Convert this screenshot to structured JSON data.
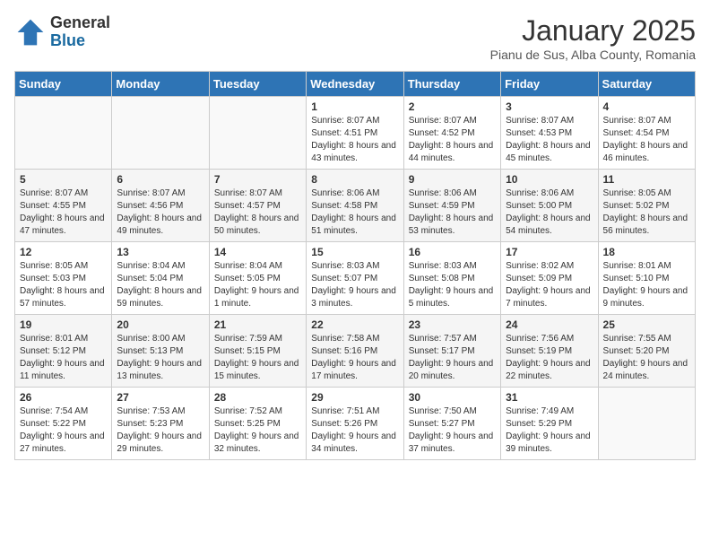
{
  "logo": {
    "general": "General",
    "blue": "Blue"
  },
  "header": {
    "title": "January 2025",
    "subtitle": "Pianu de Sus, Alba County, Romania"
  },
  "days_of_week": [
    "Sunday",
    "Monday",
    "Tuesday",
    "Wednesday",
    "Thursday",
    "Friday",
    "Saturday"
  ],
  "weeks": [
    [
      {
        "day": "",
        "info": ""
      },
      {
        "day": "",
        "info": ""
      },
      {
        "day": "",
        "info": ""
      },
      {
        "day": "1",
        "info": "Sunrise: 8:07 AM\nSunset: 4:51 PM\nDaylight: 8 hours\nand 43 minutes."
      },
      {
        "day": "2",
        "info": "Sunrise: 8:07 AM\nSunset: 4:52 PM\nDaylight: 8 hours\nand 44 minutes."
      },
      {
        "day": "3",
        "info": "Sunrise: 8:07 AM\nSunset: 4:53 PM\nDaylight: 8 hours\nand 45 minutes."
      },
      {
        "day": "4",
        "info": "Sunrise: 8:07 AM\nSunset: 4:54 PM\nDaylight: 8 hours\nand 46 minutes."
      }
    ],
    [
      {
        "day": "5",
        "info": "Sunrise: 8:07 AM\nSunset: 4:55 PM\nDaylight: 8 hours\nand 47 minutes."
      },
      {
        "day": "6",
        "info": "Sunrise: 8:07 AM\nSunset: 4:56 PM\nDaylight: 8 hours\nand 49 minutes."
      },
      {
        "day": "7",
        "info": "Sunrise: 8:07 AM\nSunset: 4:57 PM\nDaylight: 8 hours\nand 50 minutes."
      },
      {
        "day": "8",
        "info": "Sunrise: 8:06 AM\nSunset: 4:58 PM\nDaylight: 8 hours\nand 51 minutes."
      },
      {
        "day": "9",
        "info": "Sunrise: 8:06 AM\nSunset: 4:59 PM\nDaylight: 8 hours\nand 53 minutes."
      },
      {
        "day": "10",
        "info": "Sunrise: 8:06 AM\nSunset: 5:00 PM\nDaylight: 8 hours\nand 54 minutes."
      },
      {
        "day": "11",
        "info": "Sunrise: 8:05 AM\nSunset: 5:02 PM\nDaylight: 8 hours\nand 56 minutes."
      }
    ],
    [
      {
        "day": "12",
        "info": "Sunrise: 8:05 AM\nSunset: 5:03 PM\nDaylight: 8 hours\nand 57 minutes."
      },
      {
        "day": "13",
        "info": "Sunrise: 8:04 AM\nSunset: 5:04 PM\nDaylight: 8 hours\nand 59 minutes."
      },
      {
        "day": "14",
        "info": "Sunrise: 8:04 AM\nSunset: 5:05 PM\nDaylight: 9 hours\nand 1 minute."
      },
      {
        "day": "15",
        "info": "Sunrise: 8:03 AM\nSunset: 5:07 PM\nDaylight: 9 hours\nand 3 minutes."
      },
      {
        "day": "16",
        "info": "Sunrise: 8:03 AM\nSunset: 5:08 PM\nDaylight: 9 hours\nand 5 minutes."
      },
      {
        "day": "17",
        "info": "Sunrise: 8:02 AM\nSunset: 5:09 PM\nDaylight: 9 hours\nand 7 minutes."
      },
      {
        "day": "18",
        "info": "Sunrise: 8:01 AM\nSunset: 5:10 PM\nDaylight: 9 hours\nand 9 minutes."
      }
    ],
    [
      {
        "day": "19",
        "info": "Sunrise: 8:01 AM\nSunset: 5:12 PM\nDaylight: 9 hours\nand 11 minutes."
      },
      {
        "day": "20",
        "info": "Sunrise: 8:00 AM\nSunset: 5:13 PM\nDaylight: 9 hours\nand 13 minutes."
      },
      {
        "day": "21",
        "info": "Sunrise: 7:59 AM\nSunset: 5:15 PM\nDaylight: 9 hours\nand 15 minutes."
      },
      {
        "day": "22",
        "info": "Sunrise: 7:58 AM\nSunset: 5:16 PM\nDaylight: 9 hours\nand 17 minutes."
      },
      {
        "day": "23",
        "info": "Sunrise: 7:57 AM\nSunset: 5:17 PM\nDaylight: 9 hours\nand 20 minutes."
      },
      {
        "day": "24",
        "info": "Sunrise: 7:56 AM\nSunset: 5:19 PM\nDaylight: 9 hours\nand 22 minutes."
      },
      {
        "day": "25",
        "info": "Sunrise: 7:55 AM\nSunset: 5:20 PM\nDaylight: 9 hours\nand 24 minutes."
      }
    ],
    [
      {
        "day": "26",
        "info": "Sunrise: 7:54 AM\nSunset: 5:22 PM\nDaylight: 9 hours\nand 27 minutes."
      },
      {
        "day": "27",
        "info": "Sunrise: 7:53 AM\nSunset: 5:23 PM\nDaylight: 9 hours\nand 29 minutes."
      },
      {
        "day": "28",
        "info": "Sunrise: 7:52 AM\nSunset: 5:25 PM\nDaylight: 9 hours\nand 32 minutes."
      },
      {
        "day": "29",
        "info": "Sunrise: 7:51 AM\nSunset: 5:26 PM\nDaylight: 9 hours\nand 34 minutes."
      },
      {
        "day": "30",
        "info": "Sunrise: 7:50 AM\nSunset: 5:27 PM\nDaylight: 9 hours\nand 37 minutes."
      },
      {
        "day": "31",
        "info": "Sunrise: 7:49 AM\nSunset: 5:29 PM\nDaylight: 9 hours\nand 39 minutes."
      },
      {
        "day": "",
        "info": ""
      }
    ]
  ]
}
